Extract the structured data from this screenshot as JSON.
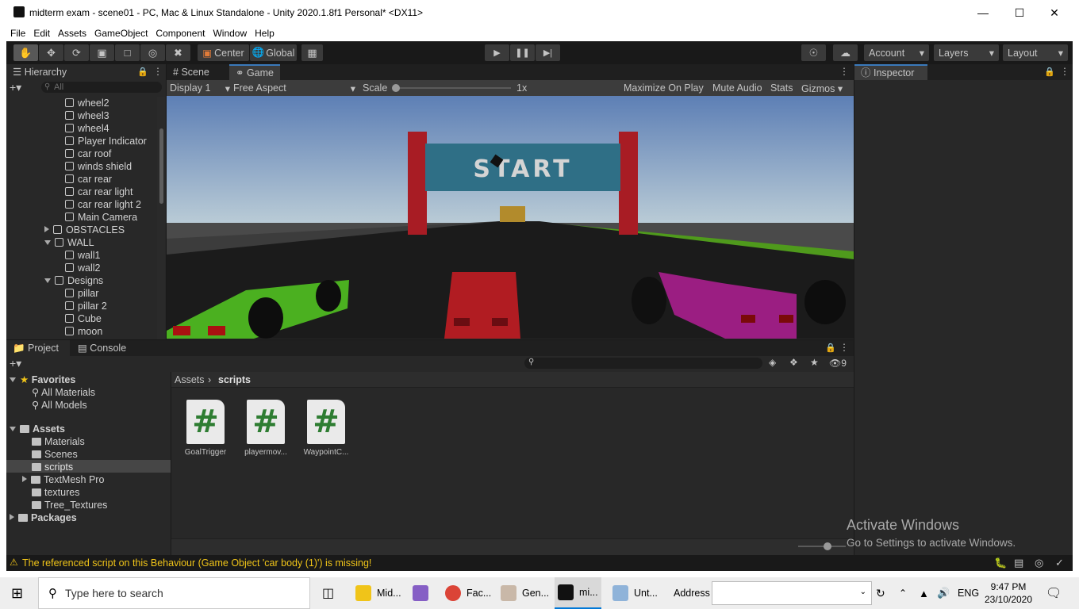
{
  "window": {
    "title": "midterm exam - scene01 - PC, Mac & Linux Standalone - Unity 2020.1.8f1 Personal* <DX11>"
  },
  "menu": [
    "File",
    "Edit",
    "Assets",
    "GameObject",
    "Component",
    "Window",
    "Help"
  ],
  "toolbar": {
    "pivot": "Center",
    "space": "Global",
    "account": "Account",
    "layers": "Layers",
    "layout": "Layout"
  },
  "hierarchy": {
    "tab": "Hierarchy",
    "search_placeholder": "All",
    "items": [
      {
        "label": "wheel2",
        "depth": 2,
        "arrow": "none"
      },
      {
        "label": "wheel3",
        "depth": 2,
        "arrow": "none"
      },
      {
        "label": "wheel4",
        "depth": 2,
        "arrow": "none"
      },
      {
        "label": "Player Indicator",
        "depth": 2,
        "arrow": "none"
      },
      {
        "label": "car roof",
        "depth": 2,
        "arrow": "none"
      },
      {
        "label": "winds shield",
        "depth": 2,
        "arrow": "none"
      },
      {
        "label": "car rear",
        "depth": 2,
        "arrow": "none"
      },
      {
        "label": "car rear light",
        "depth": 2,
        "arrow": "none"
      },
      {
        "label": "car rear light 2",
        "depth": 2,
        "arrow": "none"
      },
      {
        "label": "Main Camera",
        "depth": 2,
        "arrow": "none"
      },
      {
        "label": "OBSTACLES",
        "depth": 1,
        "arrow": "right"
      },
      {
        "label": "WALL",
        "depth": 1,
        "arrow": "down"
      },
      {
        "label": "wall1",
        "depth": 2,
        "arrow": "none"
      },
      {
        "label": "wall2",
        "depth": 2,
        "arrow": "none"
      },
      {
        "label": "Designs",
        "depth": 1,
        "arrow": "down"
      },
      {
        "label": "pillar",
        "depth": 2,
        "arrow": "none"
      },
      {
        "label": "pillar 2",
        "depth": 2,
        "arrow": "none"
      },
      {
        "label": "Cube",
        "depth": 2,
        "arrow": "none"
      },
      {
        "label": "moon",
        "depth": 2,
        "arrow": "none"
      }
    ]
  },
  "scene_tabs": {
    "scene": "Scene",
    "game": "Game"
  },
  "game_bar": {
    "display": "Display 1",
    "aspect": "Free Aspect",
    "scale_label": "Scale",
    "scale_value": "1x",
    "maximize": "Maximize On Play",
    "mute": "Mute Audio",
    "stats": "Stats",
    "gizmos": "Gizmos"
  },
  "game_view": {
    "banner": "START"
  },
  "inspector": {
    "tab": "Inspector"
  },
  "project": {
    "tab_project": "Project",
    "tab_console": "Console",
    "hidden_count": "9",
    "favorites": {
      "label": "Favorites",
      "items": [
        "All Materials",
        "All Models"
      ]
    },
    "assets": {
      "label": "Assets",
      "items": [
        "Materials",
        "Scenes",
        "scripts",
        "TextMesh Pro",
        "textures",
        "Tree_Textures"
      ]
    },
    "packages": "Packages",
    "breadcrumb": [
      "Assets",
      "scripts"
    ],
    "files": [
      "GoalTrigger",
      "playermov...",
      "WaypointC..."
    ]
  },
  "status": {
    "message": "The referenced script on this Behaviour (Game Object 'car body (1)') is missing!"
  },
  "watermark": {
    "line1": "Activate Windows",
    "line2": "Go to Settings to activate Windows."
  },
  "taskbar": {
    "search": "Type here to search",
    "apps": [
      "Mid...",
      "Fac...",
      "Gen...",
      "mi...",
      "Unt..."
    ],
    "address_label": "Address",
    "lang": "ENG",
    "time": "9:47 PM",
    "date": "23/10/2020"
  }
}
